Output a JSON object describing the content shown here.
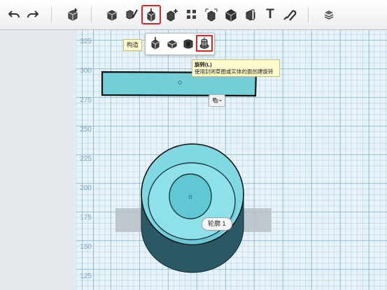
{
  "toolbar": {
    "items": [
      {
        "name": "undo-icon"
      },
      {
        "name": "redo-icon"
      },
      {
        "name": "import-icon"
      },
      {
        "name": "primitive-box-icon"
      },
      {
        "name": "sketch-icon"
      },
      {
        "name": "construct-icon",
        "active": true
      },
      {
        "name": "modify-icon"
      },
      {
        "name": "pattern-icon"
      },
      {
        "name": "group-icon"
      },
      {
        "name": "combine-icon"
      },
      {
        "name": "measure-icon"
      },
      {
        "name": "text-icon",
        "glyph": "T"
      },
      {
        "name": "snap-icon"
      },
      {
        "name": "material-icon"
      }
    ]
  },
  "construct_tag": "构造",
  "submenu": {
    "items": [
      {
        "name": "extrude-icon"
      },
      {
        "name": "sweep-icon"
      },
      {
        "name": "loft-icon"
      },
      {
        "name": "revolve-icon",
        "active": true
      }
    ]
  },
  "tooltip": {
    "title": "旋转(L)",
    "description": "使用封闭草图或实体的面创建旋转"
  },
  "profile_label": "轮廓 1",
  "y_axis_labels": [
    "325",
    "300",
    "275",
    "250",
    "225",
    "200",
    "175",
    "150",
    "125"
  ],
  "colors": {
    "accent_red": "#e02323",
    "solid_cyan": "#7fd9e3",
    "solid_dark": "#2b4f5a",
    "grid": "#e7f3f8"
  }
}
